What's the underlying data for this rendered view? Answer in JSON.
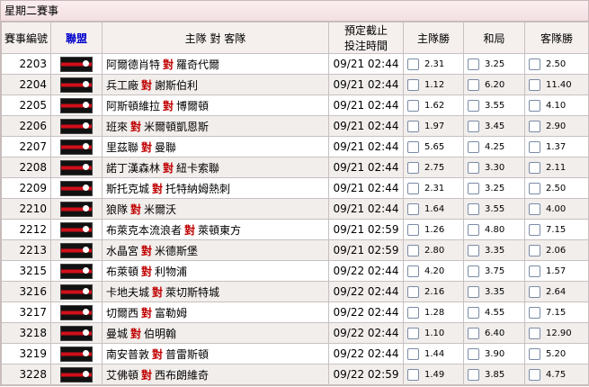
{
  "page_title": "星期二賽事",
  "headers": {
    "match_no": "賽事編號",
    "league": "聯盟",
    "teams": "主隊 對 客隊",
    "cutoff_line1": "預定截止",
    "cutoff_line2": "投注時間",
    "home_win": "主隊勝",
    "draw": "和局",
    "away_win": "客隊勝"
  },
  "vs_label": "對",
  "matches": [
    {
      "no": "2203",
      "home": "阿爾德肖特",
      "away": "羅奇代爾",
      "time": "09/21 02:44",
      "h": "2.31",
      "d": "3.25",
      "a": "2.50"
    },
    {
      "no": "2204",
      "home": "兵工廠",
      "away": "謝斯伯利",
      "time": "09/21 02:44",
      "h": "1.12",
      "d": "6.20",
      "a": "11.40"
    },
    {
      "no": "2205",
      "home": "阿斯頓維拉",
      "away": "博爾頓",
      "time": "09/21 02:44",
      "h": "1.62",
      "d": "3.55",
      "a": "4.10"
    },
    {
      "no": "2206",
      "home": "班來",
      "away": "米爾頓凱恩斯",
      "time": "09/21 02:44",
      "h": "1.97",
      "d": "3.45",
      "a": "2.90"
    },
    {
      "no": "2207",
      "home": "里茲聯",
      "away": "曼聯",
      "time": "09/21 02:44",
      "h": "5.65",
      "d": "4.25",
      "a": "1.37"
    },
    {
      "no": "2208",
      "home": "諾丁漢森林",
      "away": "紐卡索聯",
      "time": "09/21 02:44",
      "h": "2.75",
      "d": "3.30",
      "a": "2.11"
    },
    {
      "no": "2209",
      "home": "斯托克城",
      "away": "托特納姆熱刺",
      "time": "09/21 02:44",
      "h": "2.31",
      "d": "3.25",
      "a": "2.50"
    },
    {
      "no": "2210",
      "home": "狼隊",
      "away": "米爾沃",
      "time": "09/21 02:44",
      "h": "1.64",
      "d": "3.55",
      "a": "4.00"
    },
    {
      "no": "2212",
      "home": "布萊克本流浪者",
      "away": "萊頓東方",
      "time": "09/21 02:59",
      "h": "1.26",
      "d": "4.80",
      "a": "7.15"
    },
    {
      "no": "2213",
      "home": "水晶宮",
      "away": "米德斯堡",
      "time": "09/21 02:59",
      "h": "2.80",
      "d": "3.35",
      "a": "2.06"
    },
    {
      "no": "3215",
      "home": "布萊頓",
      "away": "利物浦",
      "time": "09/22 02:44",
      "h": "4.20",
      "d": "3.75",
      "a": "1.57"
    },
    {
      "no": "3216",
      "home": "卡地夫城",
      "away": "萊切斯特城",
      "time": "09/22 02:44",
      "h": "2.16",
      "d": "3.35",
      "a": "2.64"
    },
    {
      "no": "3217",
      "home": "切爾西",
      "away": "富勒姆",
      "time": "09/22 02:44",
      "h": "1.28",
      "d": "4.55",
      "a": "7.15"
    },
    {
      "no": "3218",
      "home": "曼城",
      "away": "伯明翰",
      "time": "09/22 02:44",
      "h": "1.10",
      "d": "6.40",
      "a": "12.90"
    },
    {
      "no": "3219",
      "home": "南安普敦",
      "away": "普雷斯頓",
      "time": "09/22 02:44",
      "h": "1.44",
      "d": "3.90",
      "a": "5.20"
    },
    {
      "no": "3228",
      "home": "艾佛頓",
      "away": "西布朗維奇",
      "time": "09/22 02:59",
      "h": "1.49",
      "d": "3.85",
      "a": "4.75"
    }
  ]
}
